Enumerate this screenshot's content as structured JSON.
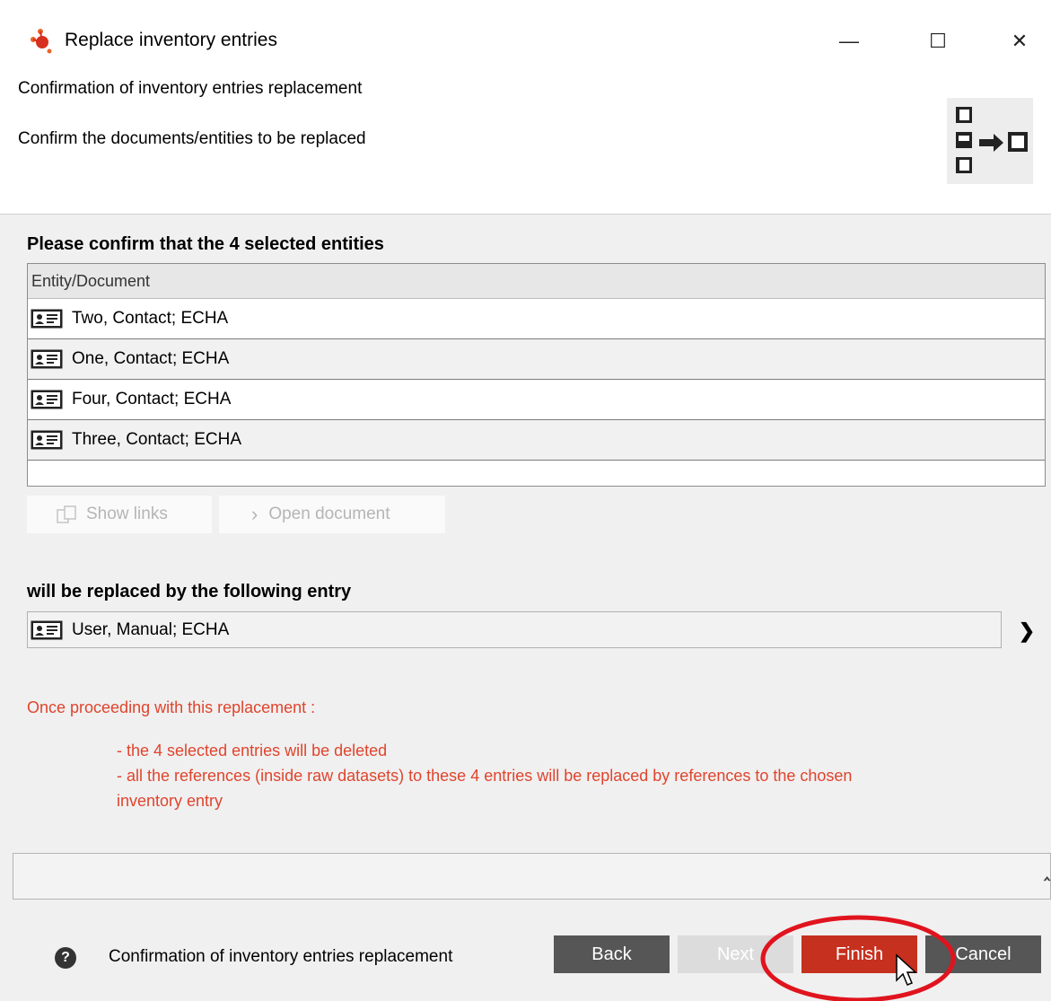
{
  "window": {
    "title": "Replace inventory entries",
    "minimize_glyph": "—",
    "maximize_glyph": "☐",
    "close_glyph": "✕"
  },
  "header": {
    "title": "Confirmation of inventory entries replacement",
    "subtitle": "Confirm the documents/entities to be replaced",
    "icon": "replace-entities-icon"
  },
  "selection": {
    "heading": "Please confirm that the 4 selected entities",
    "column_header": "Entity/Document",
    "rows": [
      {
        "label": "Two, Contact; ECHA"
      },
      {
        "label": "One, Contact; ECHA"
      },
      {
        "label": "Four, Contact; ECHA"
      },
      {
        "label": "Three, Contact; ECHA"
      }
    ],
    "show_links_label": "Show links",
    "open_document_label": "Open document"
  },
  "replacement": {
    "heading": "will be replaced by the following entry",
    "entry": "User, Manual; ECHA"
  },
  "warning": {
    "intro": "Once proceeding with this replacement :",
    "line1": "- the 4 selected entries will be deleted",
    "line2": "- all the references (inside raw datasets) to these 4 entries will be replaced by references to the chosen",
    "line3": "inventory entry",
    "color": "#e0442d"
  },
  "footer": {
    "status": "Confirmation of inventory entries replacement",
    "help_glyph": "?",
    "back_label": "Back",
    "next_label": "Next",
    "finish_label": "Finish",
    "cancel_label": "Cancel"
  },
  "colors": {
    "finish_button": "#c6301e",
    "dark_button": "#565656",
    "disabled_button": "#dcdcdc",
    "annotation_circle": "#e0141e"
  }
}
